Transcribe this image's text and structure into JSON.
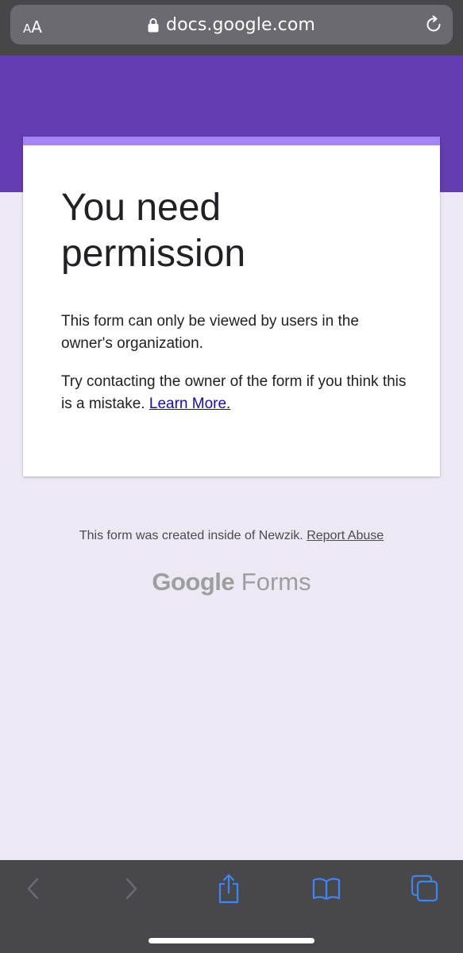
{
  "browser": {
    "text_size_small": "A",
    "text_size_large": "A",
    "url": "docs.google.com",
    "icons": [
      "lock-icon",
      "reload-icon",
      "back-icon",
      "forward-icon",
      "share-icon",
      "bookmarks-icon",
      "tabs-icon"
    ]
  },
  "card": {
    "title": "You need permission",
    "paragraph1": "This form can only be viewed by users in the owner's organization.",
    "paragraph2": "Try contacting the owner of the form if you think this is a mistake.",
    "learn_more": "Learn More."
  },
  "footer": {
    "note": "This form was created inside of Newzik.",
    "report_abuse": "Report Abuse",
    "brand_google": "Google",
    "brand_forms": "Forms"
  },
  "colors": {
    "header_purple": "#613db1",
    "card_accent": "#a585f3",
    "page_background": "#ece9f5",
    "link": "#1a0dab",
    "toolbar_icon_active": "#3d86f0",
    "toolbar_icon_disabled": "#6b6a70"
  }
}
